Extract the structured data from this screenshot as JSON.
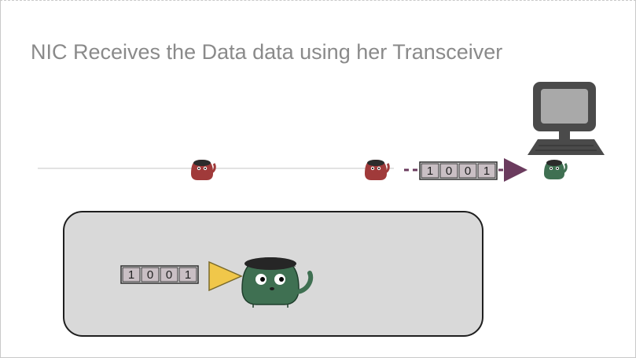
{
  "slide": {
    "title": "NIC Receives the Data data using her Transceiver"
  },
  "top_packet": {
    "bits": [
      "1",
      "0",
      "0",
      "1"
    ]
  },
  "zoom_packet": {
    "bits": [
      "1",
      "0",
      "0",
      "1"
    ]
  },
  "colors": {
    "wire": "#e2e2e2",
    "packet_arrow": "#6b3b5e",
    "sender_creature": "#a03a3a",
    "receiver_creature": "#3f7052",
    "transceiver_triangle": "#f0c74a",
    "zoom_panel": "#d9d9d9",
    "bit_cell": "#c9bfc4"
  },
  "icons": {
    "computer": "computer-icon",
    "sender_nic_left": "red-nic-creature-icon",
    "sender_nic_right": "red-nic-creature-icon",
    "receiver_nic": "green-nic-creature-icon",
    "transceiver": "transceiver-triangle-icon",
    "receiver_nic_large": "green-nic-creature-icon"
  }
}
